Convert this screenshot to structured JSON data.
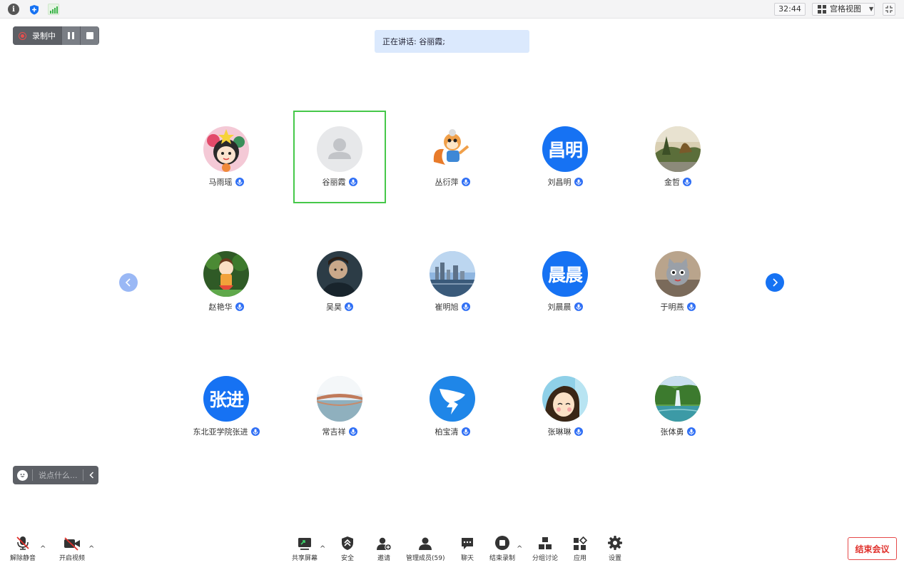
{
  "topbar": {
    "timer": "32:44",
    "view_label": "宫格视图"
  },
  "recording": {
    "label": "录制中"
  },
  "speaking": {
    "text": "正在讲话: 谷丽霞;"
  },
  "participants": [
    {
      "name": "马雨瑶",
      "avatar": "cartoon-girl",
      "active": false
    },
    {
      "name": "谷丽霞",
      "avatar": "default-person",
      "active": true
    },
    {
      "name": "丛衍萍",
      "avatar": "cartoon-squirrel",
      "active": false
    },
    {
      "name": "刘昌明",
      "avatar_text": "昌明",
      "active": false
    },
    {
      "name": "金哲",
      "avatar": "photo-garden",
      "active": false
    },
    {
      "name": "赵艳华",
      "avatar": "cartoon-totoro-girl",
      "active": false
    },
    {
      "name": "吴昊",
      "avatar": "photo-man",
      "active": false
    },
    {
      "name": "崔明旭",
      "avatar": "photo-city",
      "active": false
    },
    {
      "name": "刘晨晨",
      "avatar_text": "晨晨",
      "active": false
    },
    {
      "name": "于明燕",
      "avatar": "photo-cat-doll",
      "active": false
    },
    {
      "name": "东北亚学院张进",
      "avatar_text": "张进",
      "active": false
    },
    {
      "name": "常吉祥",
      "avatar": "photo-lake",
      "active": false
    },
    {
      "name": "柏宝清",
      "avatar": "logo-dingtalk",
      "active": false
    },
    {
      "name": "张琳琳",
      "avatar": "cartoon-girl-face",
      "active": false
    },
    {
      "name": "张体勇",
      "avatar": "photo-waterfall",
      "active": false
    }
  ],
  "chat": {
    "placeholder": "说点什么..."
  },
  "toolbar": {
    "unmute": "解除静音",
    "start_video": "开启视频",
    "share_screen": "共享屏幕",
    "security": "安全",
    "invite": "邀请",
    "manage_members": "管理成员(59)",
    "chat": "聊天",
    "stop_recording": "结束录制",
    "breakout": "分组讨论",
    "apps": "应用",
    "settings": "设置",
    "end_meeting": "结束会议"
  },
  "colors": {
    "accent": "#1672f3",
    "active_border": "#46c84a",
    "danger": "#e0302b",
    "speaking_bg": "#dbe9fd"
  }
}
